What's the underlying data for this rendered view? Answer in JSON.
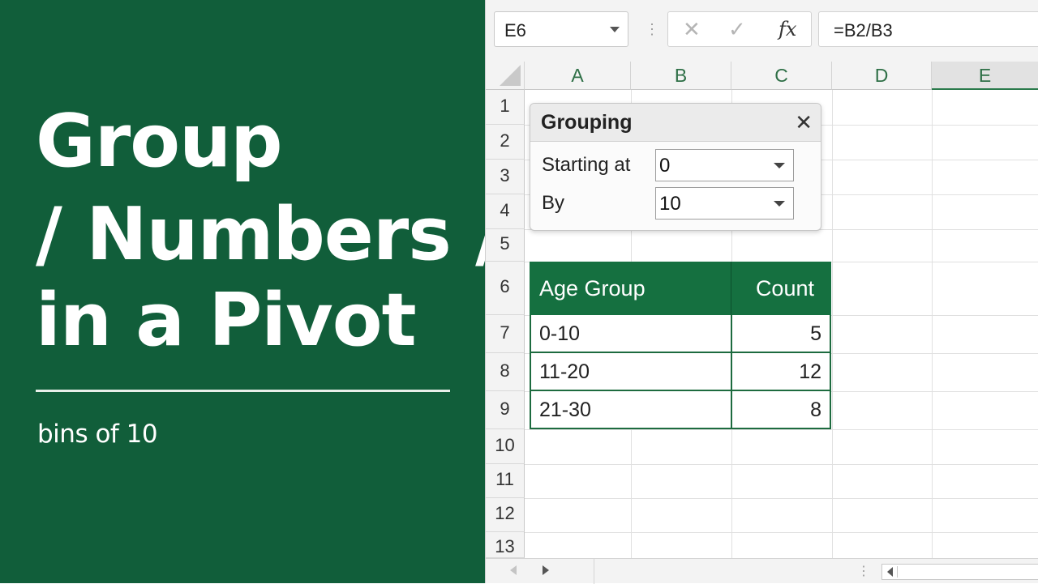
{
  "panel": {
    "title_lines": [
      "Group",
      "/ Numbers /",
      "in a Pivot"
    ],
    "subtitle": "bins of 10",
    "background": "#115e3a"
  },
  "toolbar": {
    "name_box": "E6",
    "cancel_icon": "✕",
    "enter_icon": "✓",
    "function_label": "fx",
    "formula": "=B2/B3"
  },
  "columns": [
    "A",
    "B",
    "C",
    "D",
    "E"
  ],
  "selected_column": "E",
  "rows": [
    "1",
    "2",
    "3",
    "4",
    "5",
    "6",
    "7",
    "8",
    "9",
    "10",
    "11",
    "12",
    "13"
  ],
  "dialog": {
    "title": "Grouping",
    "close_icon": "✕",
    "starting_at_label": "Starting at",
    "starting_at_value": "0",
    "by_label": "By",
    "by_value": "10"
  },
  "pivot": {
    "headers": [
      "Age Group",
      "Count"
    ],
    "rows": [
      {
        "group": "0-10",
        "count": "5"
      },
      {
        "group": "11-20",
        "count": "12"
      },
      {
        "group": "21-30",
        "count": "8"
      }
    ]
  }
}
